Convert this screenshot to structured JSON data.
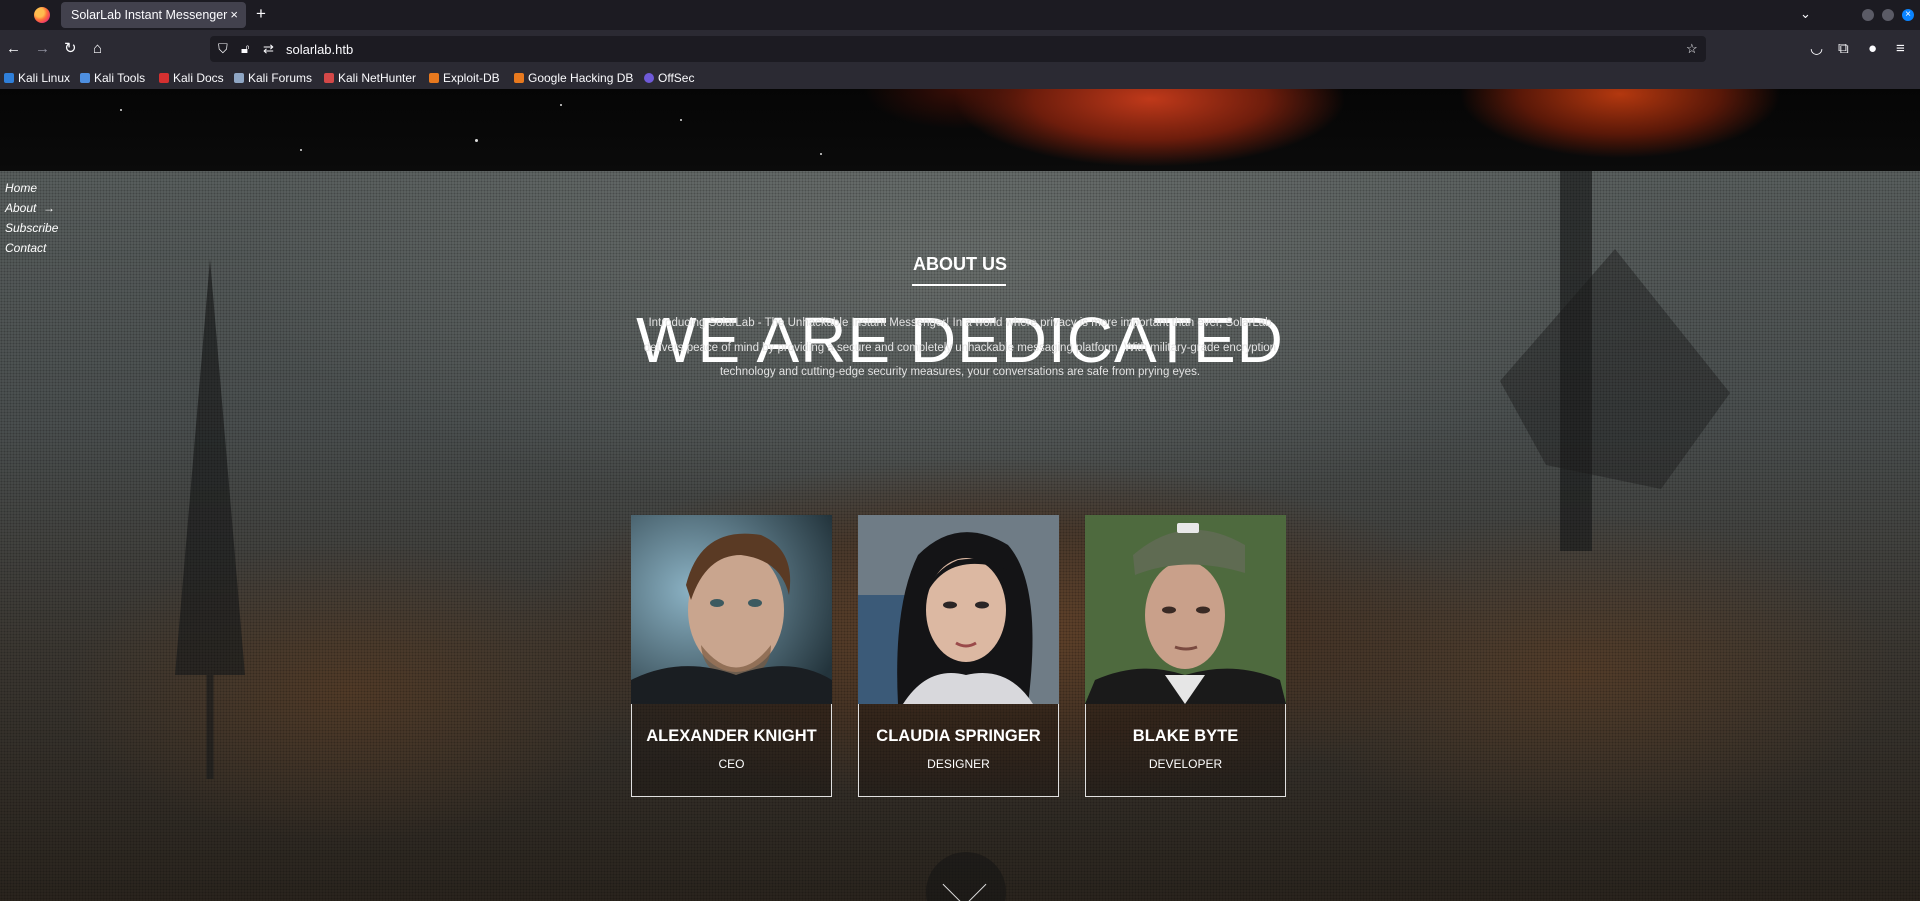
{
  "browser": {
    "tab_title": "SolarLab Instant Messenger",
    "tab_close": "×",
    "new_tab": "+",
    "tab_list": "⌄",
    "url": "solarlab.htb",
    "window_close": "×"
  },
  "bookmarks": [
    {
      "label": "Kali Linux",
      "icon_color": "#2f7fd9"
    },
    {
      "label": "Kali Tools",
      "icon_color": "#4e8fe0"
    },
    {
      "label": "Kali Docs",
      "icon_color": "#d53030"
    },
    {
      "label": "Kali Forums",
      "icon_color": "#8fa6c4"
    },
    {
      "label": "Kali NetHunter",
      "icon_color": "#d44848"
    },
    {
      "label": "Exploit-DB",
      "icon_color": "#e8791e"
    },
    {
      "label": "Google Hacking DB",
      "icon_color": "#e8791e"
    },
    {
      "label": "OffSec",
      "icon_color": "#6f5ad8"
    }
  ],
  "site": {
    "nav": [
      "Home",
      "About",
      "Subscribe",
      "Contact"
    ],
    "active_nav_marker": "→",
    "section_label": "ABOUT US",
    "headline": "WE ARE DEDICATED",
    "intro": "Introducing SolarLab - The Unhackable Instant Messenger! In a world where privacy is more important than ever, SolarLab delivers peace of mind by providing a secure and completely unhackable messaging platform. With military-grade encryption technology and cutting-edge security measures, your conversations are safe from prying eyes.",
    "team": [
      {
        "name": "ALEXANDER KNIGHT",
        "role": "CEO"
      },
      {
        "name": "CLAUDIA SPRINGER",
        "role": "DESIGNER"
      },
      {
        "name": "BLAKE BYTE",
        "role": "DEVELOPER"
      }
    ]
  }
}
